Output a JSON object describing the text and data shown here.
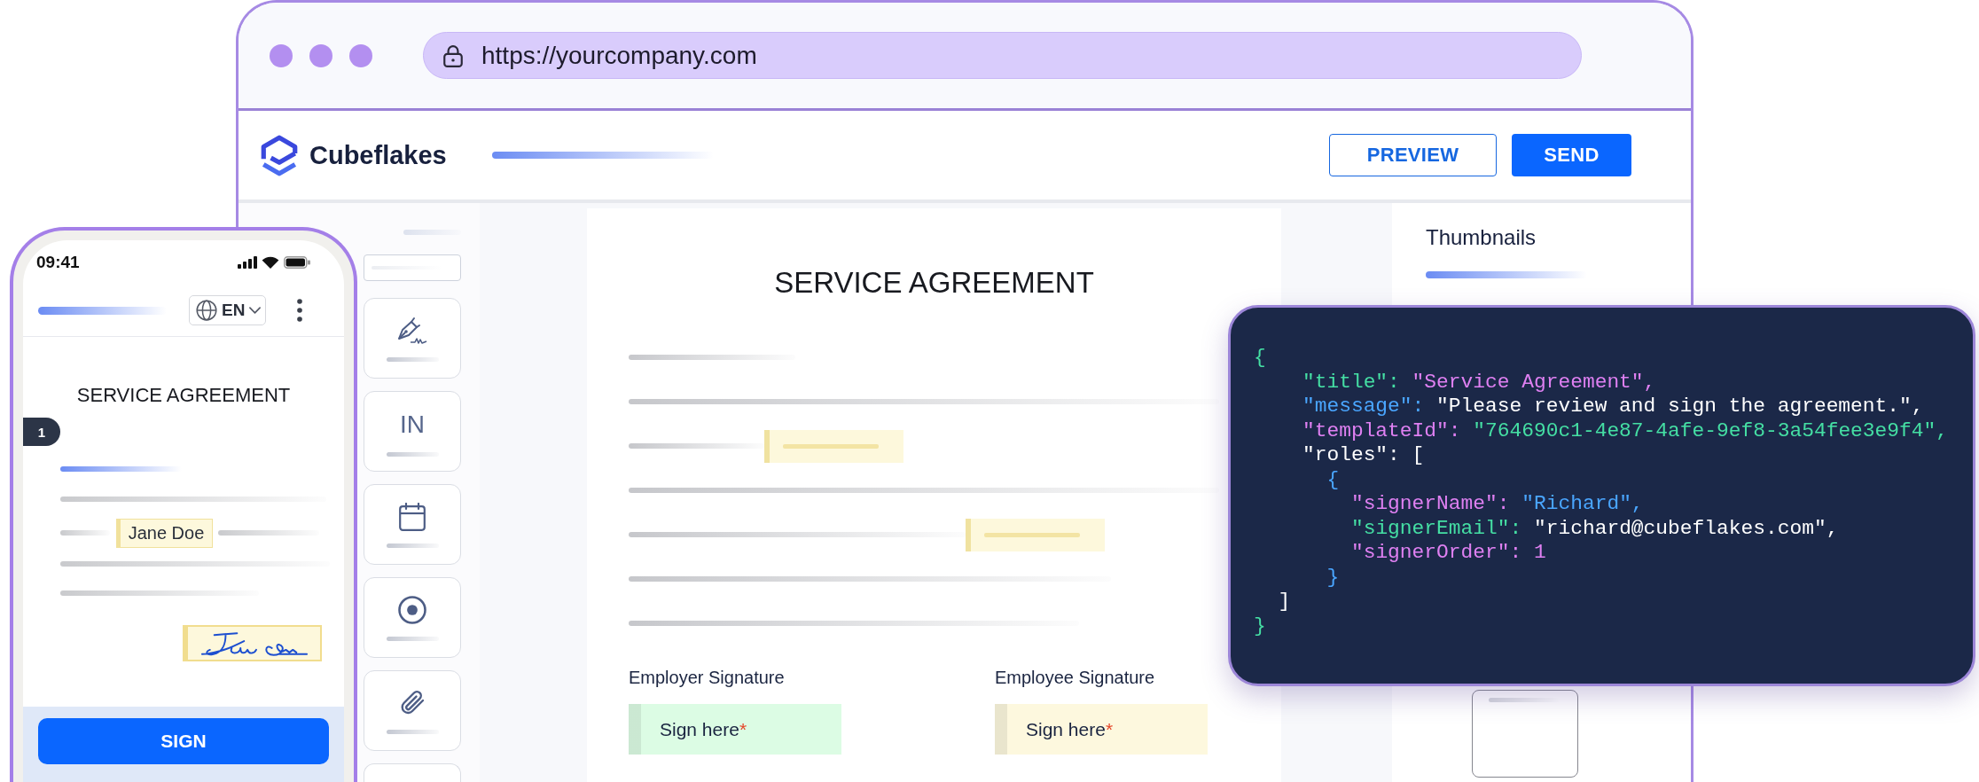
{
  "browser": {
    "url": "https://yourcompany.com"
  },
  "app_header": {
    "brand": "Cubeflakes",
    "buttons": [
      {
        "label": "PREVIEW",
        "kind": "outline"
      },
      {
        "label": "SEND",
        "kind": "primary"
      }
    ]
  },
  "tools": [
    {
      "kind": "signature"
    },
    {
      "kind": "initials",
      "label": "IN"
    },
    {
      "kind": "date"
    },
    {
      "kind": "radio"
    },
    {
      "kind": "attachment"
    },
    {
      "kind": "blank"
    }
  ],
  "document": {
    "title": "SERVICE AGREEMENT",
    "signatures": [
      {
        "label": "Employer Signature",
        "prompt": "Sign here",
        "required_mark": "*",
        "color": "#dcfce4"
      },
      {
        "label": "Employee Signature",
        "prompt": "Sign here",
        "required_mark": "*",
        "color": "#fdf8de"
      }
    ]
  },
  "thumbnails": {
    "title": "Thumbnails"
  },
  "code_panel": {
    "lines": [
      {
        "tokens": [
          {
            "text": "{",
            "color": "#45dfa4"
          }
        ]
      },
      {
        "tokens": [
          {
            "text": "    \"title\": ",
            "color": "#45dfa4"
          },
          {
            "text": "\"Service Agreement\",",
            "color": "#df80f2"
          }
        ]
      },
      {
        "tokens": [
          {
            "text": "    \"message\": ",
            "color": "#4aa6ff"
          },
          {
            "text": "\"Please review and sign the agreement.\",",
            "color": "#ffffff"
          }
        ]
      },
      {
        "tokens": [
          {
            "text": "    \"templateId\": ",
            "color": "#df80f2"
          },
          {
            "text": "\"764690c1-4e87-4afe-9ef8-3a54fee3e9f4\",",
            "color": "#45dfa4"
          }
        ]
      },
      {
        "tokens": [
          {
            "text": "    \"roles\": [",
            "color": "#ffffff"
          }
        ]
      },
      {
        "tokens": [
          {
            "text": "      {",
            "color": "#4aa6ff"
          }
        ]
      },
      {
        "tokens": [
          {
            "text": "        \"signerName\": ",
            "color": "#df80f2"
          },
          {
            "text": "\"Richard\",",
            "color": "#4aa6ff"
          }
        ]
      },
      {
        "tokens": [
          {
            "text": "        \"signerEmail\": ",
            "color": "#45dfa4"
          },
          {
            "text": "\"richard@cubeflakes.com\",",
            "color": "#ffffff"
          }
        ]
      },
      {
        "tokens": [
          {
            "text": "        \"signerOrder\": 1",
            "color": "#df80f2"
          }
        ]
      },
      {
        "tokens": [
          {
            "text": "      }",
            "color": "#4aa6ff"
          }
        ]
      },
      {
        "tokens": [
          {
            "text": "  ]",
            "color": "#ffffff"
          }
        ]
      },
      {
        "tokens": [
          {
            "text": "}",
            "color": "#45dfa4"
          }
        ]
      }
    ]
  },
  "phone": {
    "time": "09:41",
    "language": "EN",
    "title": "SERVICE AGREEMENT",
    "page_number": "1",
    "name_field": {
      "value": "Jane Doe"
    },
    "sign_button": "SIGN"
  }
}
